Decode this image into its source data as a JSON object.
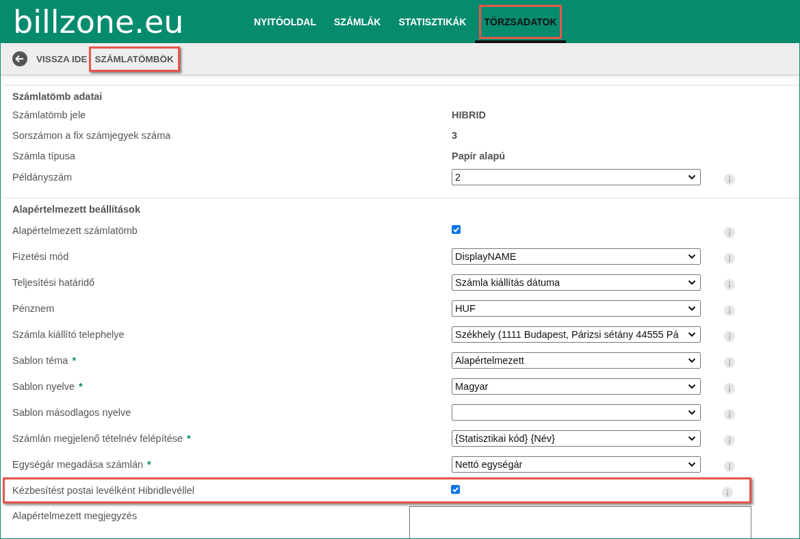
{
  "logo": "billzone.eu",
  "nav": [
    {
      "label": "NYITÓOLDAL",
      "selected": false,
      "highlighted": false
    },
    {
      "label": "SZÁMLÁK",
      "selected": false,
      "highlighted": false
    },
    {
      "label": "STATISZTIKÁK",
      "selected": false,
      "highlighted": false
    },
    {
      "label": "TÖRZSADATOK",
      "selected": true,
      "highlighted": true
    }
  ],
  "breadcrumb": {
    "back": "VISSZA IDE",
    "current": "SZÁMLATÖMBÖK",
    "highlighted": true
  },
  "sections": [
    {
      "title": "Számlatömb adatai",
      "rows": [
        {
          "kind": "static",
          "label": "Számlatömb jele",
          "value": "HIBRID",
          "info": false,
          "required": false,
          "highlighted": false
        },
        {
          "kind": "static",
          "label": "Sorszámon a fix számjegyek száma",
          "value": "3",
          "info": false,
          "required": false,
          "highlighted": false
        },
        {
          "kind": "static",
          "label": "Számla típusa",
          "value": "Papír alapú",
          "info": false,
          "required": false,
          "highlighted": false
        },
        {
          "kind": "select",
          "label": "Példányszám",
          "value": "2",
          "info": true,
          "required": false,
          "highlighted": false
        }
      ]
    },
    {
      "title": "Alapértelmezett beállítások",
      "rows": [
        {
          "kind": "checkbox",
          "label": "Alapértelmezett számlatömb",
          "checked": true,
          "info": true,
          "required": false,
          "highlighted": false
        },
        {
          "kind": "select",
          "label": "Fizetési mód",
          "value": "DisplayNAME",
          "info": true,
          "required": false,
          "highlighted": false
        },
        {
          "kind": "select",
          "label": "Teljesítési határidő",
          "value": "Számla kiállítás dátuma",
          "info": true,
          "required": false,
          "highlighted": false
        },
        {
          "kind": "select",
          "label": "Pénznem",
          "value": "HUF",
          "info": true,
          "required": false,
          "highlighted": false
        },
        {
          "kind": "select",
          "label": "Számla kiállító telephelye",
          "value": "Székhely (1111 Budapest, Párizsi sétány 44555 Pá",
          "info": true,
          "required": false,
          "highlighted": false
        },
        {
          "kind": "select",
          "label": "Sablon téma",
          "value": "Alapértelmezett",
          "info": true,
          "required": true,
          "highlighted": false
        },
        {
          "kind": "select",
          "label": "Sablon nyelve",
          "value": "Magyar",
          "info": true,
          "required": true,
          "highlighted": false
        },
        {
          "kind": "select",
          "label": "Sablon másodlagos nyelve",
          "info": true,
          "required": false,
          "highlighted": false
        },
        {
          "kind": "select",
          "label": "Számlán megjelenő tételnév felépítése",
          "value": "{Statisztikai kód} {Név}",
          "info": true,
          "required": true,
          "highlighted": false
        },
        {
          "kind": "select",
          "label": "Egységár megadása számlán",
          "value": "Nettó egységár",
          "info": true,
          "required": true,
          "highlighted": false
        },
        {
          "kind": "checkbox",
          "label": "Kézbesítést postai levélként Hibridlevéllel",
          "checked": true,
          "info": true,
          "required": false,
          "highlighted": true
        },
        {
          "kind": "textarea",
          "label": "Alapértelmezett megjegyzés",
          "info": false,
          "required": false,
          "highlighted": false
        }
      ]
    }
  ],
  "required_mark": "*"
}
